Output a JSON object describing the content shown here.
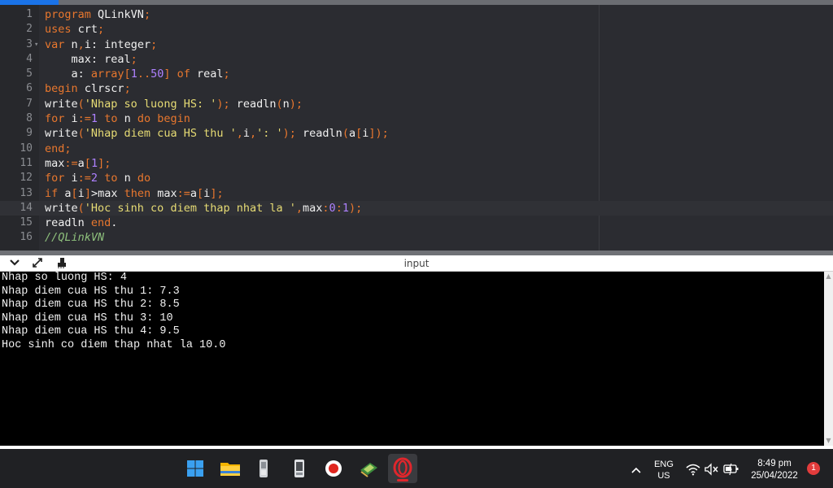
{
  "editor": {
    "lines": [
      {
        "n": "1",
        "fold": "",
        "tokens": [
          [
            "kw",
            "program "
          ],
          [
            "txt",
            "QLinkVN"
          ],
          [
            "op",
            ";"
          ]
        ]
      },
      {
        "n": "2",
        "fold": "",
        "tokens": [
          [
            "kw",
            "uses "
          ],
          [
            "txt",
            "crt"
          ],
          [
            "op",
            ";"
          ]
        ]
      },
      {
        "n": "3",
        "fold": "▾",
        "tokens": [
          [
            "kw",
            "var "
          ],
          [
            "txt",
            "n"
          ],
          [
            "op",
            ","
          ],
          [
            "txt",
            "i: integer"
          ],
          [
            "op",
            ";"
          ]
        ]
      },
      {
        "n": "4",
        "fold": "",
        "tokens": [
          [
            "txt",
            "    max: real"
          ],
          [
            "op",
            ";"
          ]
        ]
      },
      {
        "n": "5",
        "fold": "",
        "tokens": [
          [
            "txt",
            "    a: "
          ],
          [
            "kw",
            "array"
          ],
          [
            "op",
            "["
          ],
          [
            "num",
            "1"
          ],
          [
            "op",
            ".."
          ],
          [
            "num",
            "50"
          ],
          [
            "op",
            "] "
          ],
          [
            "kw",
            "of "
          ],
          [
            "txt",
            "real"
          ],
          [
            "op",
            ";"
          ]
        ]
      },
      {
        "n": "6",
        "fold": "",
        "tokens": [
          [
            "kw",
            "begin "
          ],
          [
            "txt",
            "clrscr"
          ],
          [
            "op",
            ";"
          ]
        ]
      },
      {
        "n": "7",
        "fold": "",
        "tokens": [
          [
            "txt",
            "write"
          ],
          [
            "op",
            "("
          ],
          [
            "str",
            "'Nhap so luong HS: '"
          ],
          [
            "op",
            "); "
          ],
          [
            "txt",
            "readln"
          ],
          [
            "op",
            "("
          ],
          [
            "txt",
            "n"
          ],
          [
            "op",
            ");"
          ]
        ]
      },
      {
        "n": "8",
        "fold": "",
        "tokens": [
          [
            "kw",
            "for "
          ],
          [
            "txt",
            "i"
          ],
          [
            "op",
            ":="
          ],
          [
            "num",
            "1"
          ],
          [
            "kw",
            " to "
          ],
          [
            "txt",
            "n "
          ],
          [
            "kw",
            "do begin"
          ]
        ]
      },
      {
        "n": "9",
        "fold": "",
        "tokens": [
          [
            "txt",
            "write"
          ],
          [
            "op",
            "("
          ],
          [
            "str",
            "'Nhap diem cua HS thu '"
          ],
          [
            "op",
            ","
          ],
          [
            "txt",
            "i"
          ],
          [
            "op",
            ","
          ],
          [
            "str",
            "': '"
          ],
          [
            "op",
            "); "
          ],
          [
            "txt",
            "readln"
          ],
          [
            "op",
            "("
          ],
          [
            "txt",
            "a"
          ],
          [
            "op",
            "["
          ],
          [
            "txt",
            "i"
          ],
          [
            "op",
            "]);"
          ]
        ]
      },
      {
        "n": "10",
        "fold": "",
        "tokens": [
          [
            "kw",
            "end"
          ],
          [
            "op",
            ";"
          ]
        ]
      },
      {
        "n": "11",
        "fold": "",
        "tokens": [
          [
            "txt",
            "max"
          ],
          [
            "op",
            ":="
          ],
          [
            "txt",
            "a"
          ],
          [
            "op",
            "["
          ],
          [
            "num",
            "1"
          ],
          [
            "op",
            "];"
          ]
        ]
      },
      {
        "n": "12",
        "fold": "",
        "tokens": [
          [
            "kw",
            "for "
          ],
          [
            "txt",
            "i"
          ],
          [
            "op",
            ":="
          ],
          [
            "num",
            "2"
          ],
          [
            "kw",
            " to "
          ],
          [
            "txt",
            "n "
          ],
          [
            "kw",
            "do"
          ]
        ]
      },
      {
        "n": "13",
        "fold": "",
        "tokens": [
          [
            "kw",
            "if "
          ],
          [
            "txt",
            "a"
          ],
          [
            "op",
            "["
          ],
          [
            "txt",
            "i"
          ],
          [
            "op",
            "]"
          ],
          [
            "txt",
            ">max "
          ],
          [
            "kw",
            "then "
          ],
          [
            "txt",
            "max"
          ],
          [
            "op",
            ":="
          ],
          [
            "txt",
            "a"
          ],
          [
            "op",
            "["
          ],
          [
            "txt",
            "i"
          ],
          [
            "op",
            "];"
          ]
        ]
      },
      {
        "n": "14",
        "fold": "",
        "current": true,
        "tokens": [
          [
            "txt",
            "write"
          ],
          [
            "op",
            "("
          ],
          [
            "str",
            "'Hoc sinh co diem thap nhat la '"
          ],
          [
            "op",
            ","
          ],
          [
            "txt",
            "max"
          ],
          [
            "op",
            ":"
          ],
          [
            "num",
            "0"
          ],
          [
            "op",
            ":"
          ],
          [
            "num",
            "1"
          ],
          [
            "op",
            ");"
          ]
        ]
      },
      {
        "n": "15",
        "fold": "",
        "tokens": [
          [
            "txt",
            "readln "
          ],
          [
            "kw",
            "end"
          ],
          [
            "txt",
            "."
          ]
        ]
      },
      {
        "n": "16",
        "fold": "",
        "tokens": [
          [
            "cmt",
            "//QLinkVN"
          ]
        ]
      }
    ]
  },
  "panel": {
    "title": "input",
    "icons": [
      "chevron-down-icon",
      "expand-icon",
      "clear-icon"
    ]
  },
  "console": {
    "lines": [
      "Nhap so luong HS: 4",
      "Nhap diem cua HS thu 1: 7.3",
      "Nhap diem cua HS thu 2: 8.5",
      "Nhap diem cua HS thu 3: 10",
      "Nhap diem cua HS thu 4: 9.5",
      "Hoc sinh co diem thap nhat la 10.0"
    ]
  },
  "taskbar": {
    "apps": [
      {
        "name": "windows-start-icon",
        "active": false
      },
      {
        "name": "file-explorer-icon",
        "active": false
      },
      {
        "name": "phone-link-icon",
        "active": false
      },
      {
        "name": "mobile-app-icon",
        "active": false
      },
      {
        "name": "record-icon",
        "active": false
      },
      {
        "name": "chip-app-icon",
        "active": false
      },
      {
        "name": "opera-icon",
        "active": true
      }
    ],
    "language": "ENG",
    "region": "US",
    "time": "8:49 pm",
    "date": "25/04/2022",
    "notification_count": "1"
  }
}
